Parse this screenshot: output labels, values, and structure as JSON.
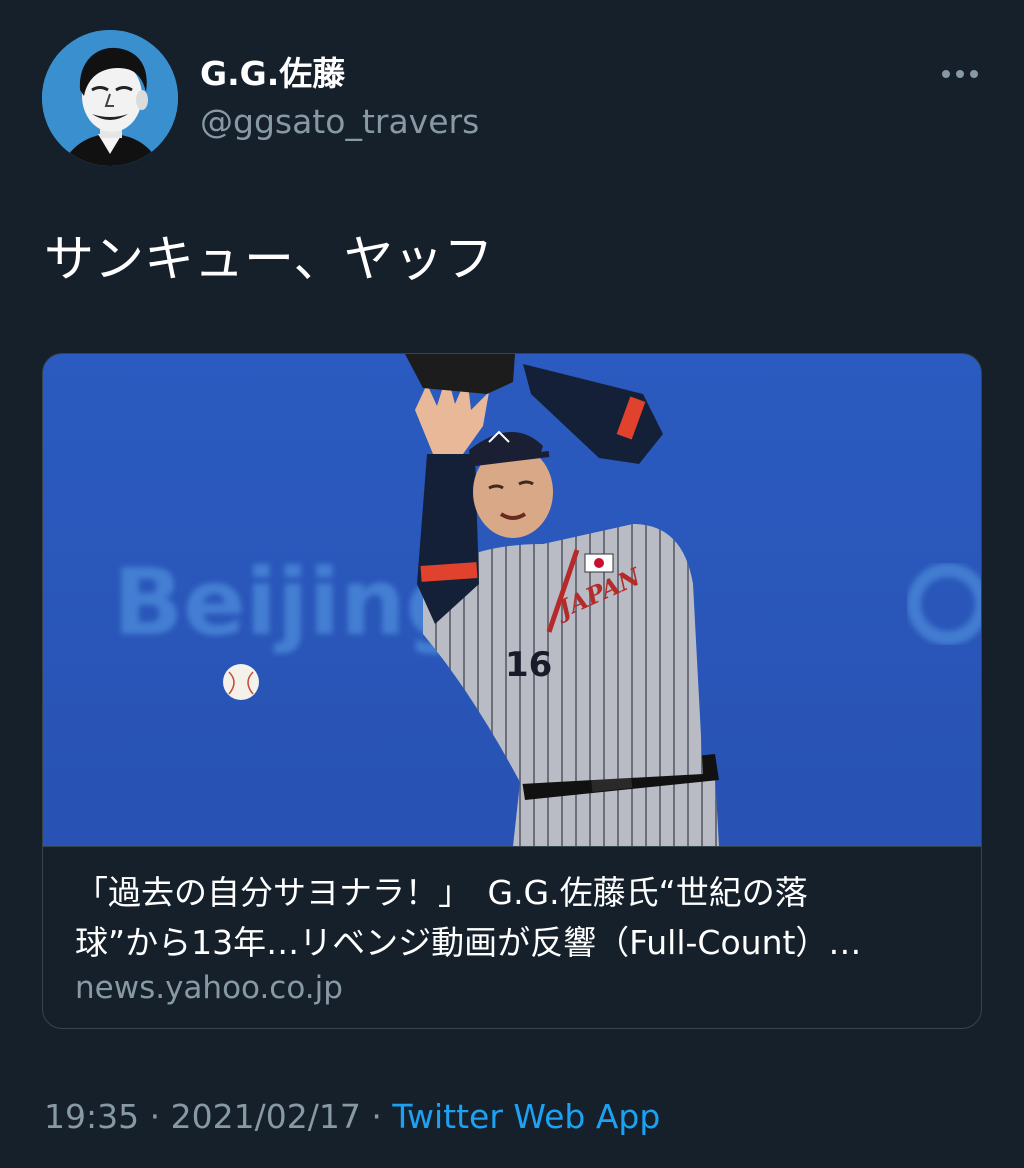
{
  "author": {
    "display_name": "G.G.佐藤",
    "handle": "@ggsato_travers"
  },
  "tweet": {
    "text": "サンキュー、ヤッフ"
  },
  "card": {
    "title_line1": "「過去の自分サヨナラ！」　G.G.佐藤氏“世紀の落",
    "title_line2": "球”から13年…リベンジ動画が反響（Full-Count）…",
    "domain": "news.yahoo.co.jp",
    "image_text": "Beijing",
    "jersey_text": "JAPAN",
    "jersey_number": "16"
  },
  "meta": {
    "time": "19:35",
    "separator": "·",
    "date": "2021/02/17",
    "source": "Twitter Web App"
  },
  "icons": {
    "more": "more-horizontal-icon"
  },
  "colors": {
    "background": "#15202b",
    "secondary_text": "#8899a6",
    "link": "#1da1f2",
    "border": "#38444d"
  }
}
